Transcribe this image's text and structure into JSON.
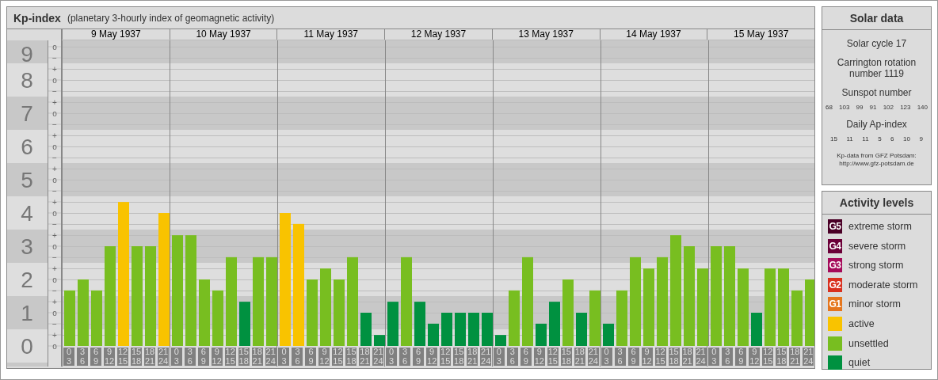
{
  "header": {
    "title": "Kp-index",
    "subtitle": "(planetary 3-hourly index of geomagnetic activity)"
  },
  "kp_chart": {
    "days": [
      "9 May 1937",
      "10 May 1937",
      "11 May 1937",
      "12 May 1937",
      "13 May 1937",
      "14 May 1937",
      "15 May 1937"
    ],
    "subscale": [
      "o",
      "−",
      "+",
      "o",
      "−",
      "+",
      "o",
      "−",
      "+",
      "o",
      "−",
      "+",
      "o",
      "−",
      "+",
      "o",
      "−",
      "+",
      "o",
      "−",
      "+",
      "o",
      "−",
      "+",
      "o",
      "−",
      "+",
      "o"
    ],
    "chart_data": {
      "type": "bar",
      "grid": true,
      "ylim": [
        0,
        9
      ],
      "yticks": [
        0,
        1,
        2,
        3,
        4,
        5,
        6,
        7,
        8,
        9
      ],
      "categories": [
        "0 3",
        "3 6",
        "6 9",
        "9 12",
        "12 15",
        "15 18",
        "18 21",
        "21 24",
        "0 3",
        "3 6",
        "6 9",
        "9 12",
        "12 15",
        "15 18",
        "18 21",
        "21 24",
        "0 3",
        "3 6",
        "6 9",
        "9 12",
        "12 15",
        "15 18",
        "18 21",
        "21 24",
        "0 3",
        "3 6",
        "6 9",
        "9 12",
        "12 15",
        "15 18",
        "18 21",
        "21 24",
        "0 3",
        "3 6",
        "6 9",
        "9 12",
        "12 15",
        "15 18",
        "18 21",
        "21 24",
        "0 3",
        "3 6",
        "6 9",
        "9 12",
        "12 15",
        "15 18",
        "18 21",
        "21 24",
        "0 3",
        "3 6",
        "6 9",
        "9 12",
        "12 15",
        "15 18",
        "18 21",
        "21 24"
      ],
      "series": [
        {
          "name": "active",
          "color": "#f9c300",
          "values": [
            null,
            null,
            null,
            null,
            4.33,
            null,
            null,
            4,
            null,
            null,
            null,
            null,
            null,
            null,
            null,
            null,
            4,
            3.67,
            null,
            null,
            null,
            null,
            null,
            null,
            null,
            null,
            null,
            null,
            null,
            null,
            null,
            null,
            null,
            null,
            null,
            null,
            null,
            null,
            null,
            null,
            null,
            null,
            null,
            null,
            null,
            null,
            null,
            null,
            null,
            null,
            null,
            null,
            null,
            null,
            null,
            null
          ]
        },
        {
          "name": "unsettled",
          "color": "#78be20",
          "values": [
            1.67,
            2,
            1.67,
            3,
            null,
            3,
            3,
            null,
            3.33,
            3.33,
            2,
            1.67,
            2.67,
            null,
            2.67,
            2.67,
            null,
            null,
            2,
            2.33,
            2,
            2.67,
            null,
            null,
            null,
            2.67,
            null,
            null,
            null,
            null,
            null,
            null,
            null,
            1.67,
            2.67,
            null,
            null,
            2,
            null,
            1.67,
            null,
            1.67,
            2.67,
            2.33,
            2.67,
            3.33,
            3,
            2.33,
            3,
            3,
            2.33,
            null,
            2.33,
            2.33,
            1.67,
            2
          ]
        },
        {
          "name": "quiet",
          "color": "#009140",
          "values": [
            null,
            null,
            null,
            null,
            null,
            null,
            null,
            null,
            null,
            null,
            null,
            null,
            null,
            1.33,
            null,
            null,
            null,
            null,
            null,
            null,
            null,
            null,
            1,
            0.33,
            1.33,
            null,
            1.33,
            0.67,
            1,
            1,
            1,
            1,
            0.33,
            null,
            null,
            0.67,
            1.33,
            null,
            1,
            null,
            0.67,
            null,
            null,
            null,
            null,
            null,
            null,
            null,
            null,
            null,
            null,
            1,
            null,
            null,
            null,
            null
          ]
        }
      ]
    }
  },
  "solar_data": {
    "title": "Solar data",
    "solar_cycle": "Solar cycle 17",
    "carrington": "Carrington rotation number 1119",
    "sunspot_label": "Sunspot number",
    "sunspot_numbers": [
      "68",
      "103",
      "99",
      "91",
      "102",
      "123",
      "140"
    ],
    "ap_label": "Daily Ap-index",
    "ap_values": [
      "15",
      "11",
      "11",
      "5",
      "6",
      "10",
      "9"
    ],
    "source": "Kp-data from GFZ Potsdam:",
    "source_link": "http://www.gfz-potsdam.de"
  },
  "activity_levels": {
    "title": "Activity levels",
    "storm_items": [
      {
        "badge": "G5",
        "label": "extreme storm",
        "color": "#4a0026"
      },
      {
        "badge": "G4",
        "label": "severe storm",
        "color": "#6b0038"
      },
      {
        "badge": "G3",
        "label": "strong storm",
        "color": "#a50a5a"
      },
      {
        "badge": "G2",
        "label": "moderate storm",
        "color": "#d9301f"
      },
      {
        "badge": "G1",
        "label": "minor storm",
        "color": "#e5761d"
      }
    ]
  }
}
